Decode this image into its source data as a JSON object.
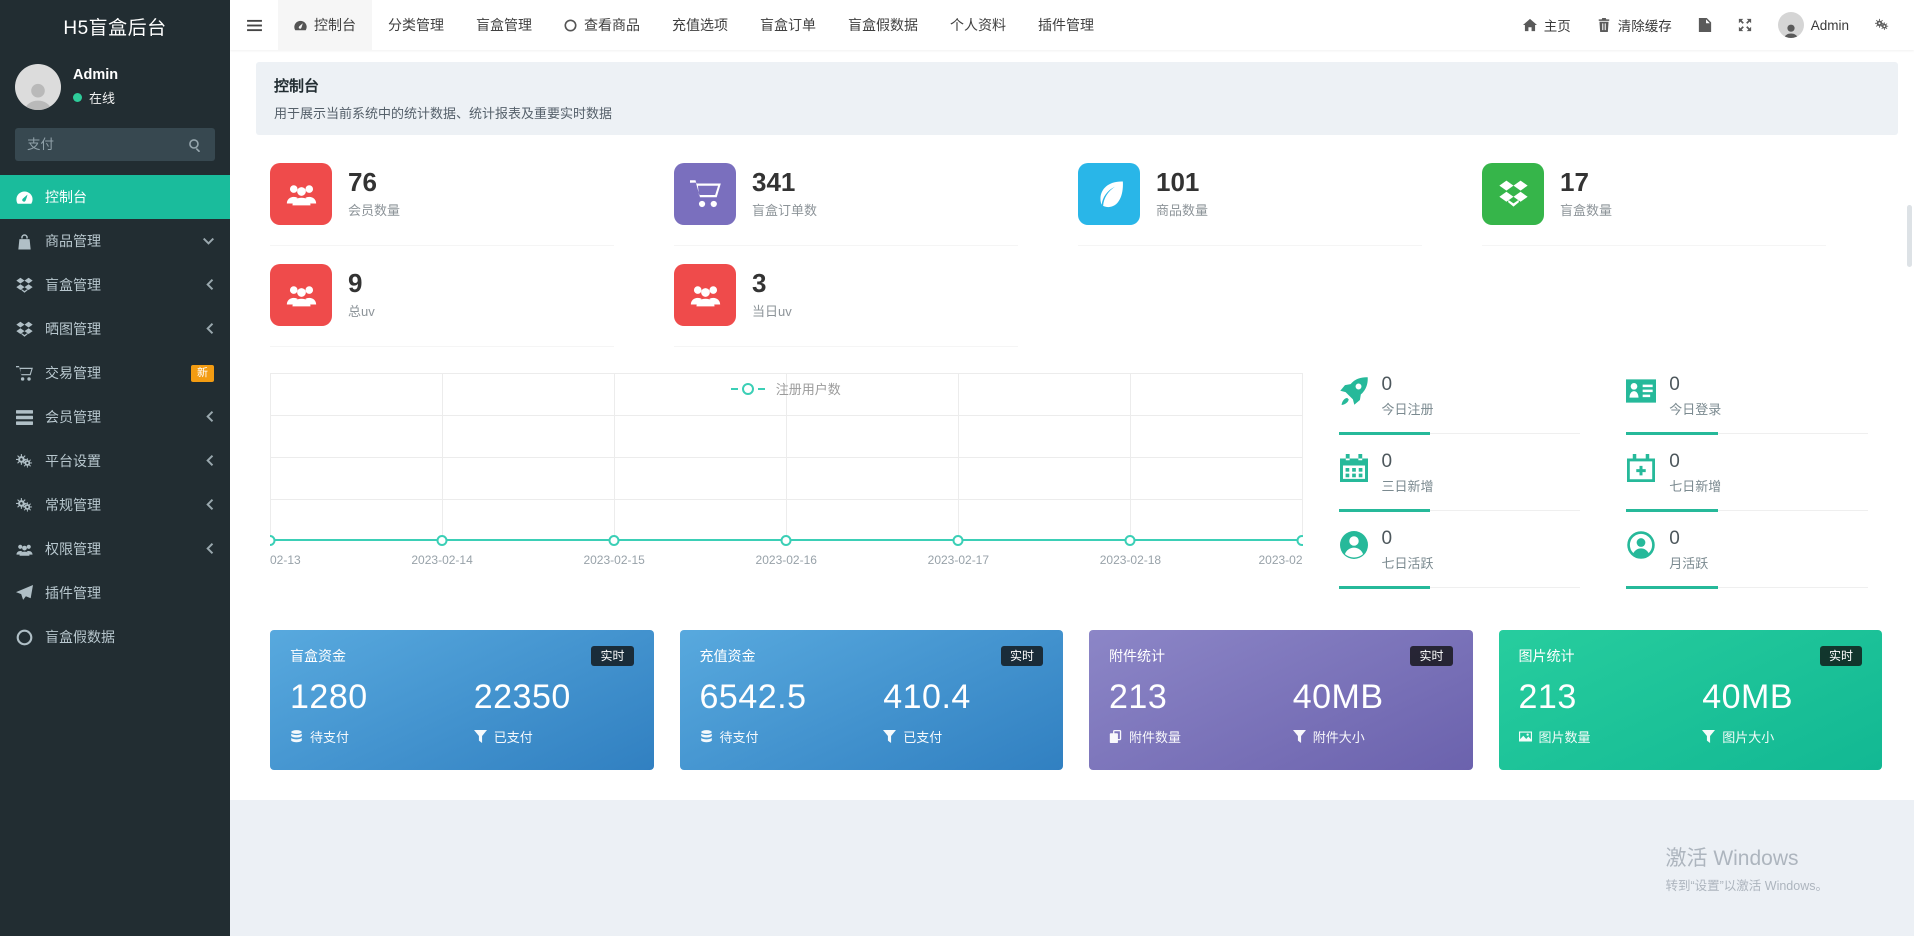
{
  "app": {
    "title": "H5盲盒后台"
  },
  "sidebar": {
    "user": {
      "name": "Admin",
      "status": "在线"
    },
    "search": {
      "placeholder": "支付"
    },
    "items": [
      {
        "label": "控制台",
        "icon": "dashboard-icon",
        "active": true
      },
      {
        "label": "商品管理",
        "icon": "shopping-bag-icon",
        "arrow": "down"
      },
      {
        "label": "盲盒管理",
        "icon": "blindbox-icon",
        "arrow": "left"
      },
      {
        "label": "晒图管理",
        "icon": "photo-box-icon",
        "arrow": "left"
      },
      {
        "label": "交易管理",
        "icon": "cart-icon",
        "badge": "新"
      },
      {
        "label": "会员管理",
        "icon": "table-icon",
        "arrow": "left"
      },
      {
        "label": "平台设置",
        "icon": "gears-icon",
        "arrow": "left"
      },
      {
        "label": "常规管理",
        "icon": "gears-icon",
        "arrow": "left"
      },
      {
        "label": "权限管理",
        "icon": "users-icon",
        "arrow": "left"
      },
      {
        "label": "插件管理",
        "icon": "paper-plane-icon"
      },
      {
        "label": "盲盒假数据",
        "icon": "circle-icon"
      }
    ]
  },
  "navbar": {
    "tabs": [
      {
        "label": "控制台",
        "icon": "dashboard-icon",
        "active": true
      },
      {
        "label": "分类管理"
      },
      {
        "label": "盲盒管理"
      },
      {
        "label": "查看商品",
        "icon": "circle-icon"
      },
      {
        "label": "充值选项"
      },
      {
        "label": "盲盒订单"
      },
      {
        "label": "盲盒假数据"
      },
      {
        "label": "个人资料"
      },
      {
        "label": "插件管理"
      }
    ],
    "home_label": "主页",
    "clear_cache_label": "清除缓存",
    "user_label": "Admin"
  },
  "page": {
    "title": "控制台",
    "subtitle": "用于展示当前系统中的统计数据、统计报表及重要实时数据"
  },
  "stats": [
    {
      "value": "76",
      "label": "会员数量",
      "color": "#ef4b4b",
      "icon": "users-icon"
    },
    {
      "value": "341",
      "label": "盲盒订单数",
      "color": "#7a6fbe",
      "icon": "cart-icon"
    },
    {
      "value": "101",
      "label": "商品数量",
      "color": "#29b6e8",
      "icon": "leaf-icon"
    },
    {
      "value": "17",
      "label": "盲盒数量",
      "color": "#36b54a",
      "icon": "blindbox-icon"
    },
    {
      "value": "9",
      "label": "总uv",
      "color": "#ef4b4b",
      "icon": "users-icon"
    },
    {
      "value": "3",
      "label": "当日uv",
      "color": "#ef4b4b",
      "icon": "users-icon"
    }
  ],
  "chart_data": {
    "type": "line",
    "title": "",
    "legend": [
      "注册用户数"
    ],
    "legend_position": "top-center",
    "x": [
      "02-13",
      "2023-02-14",
      "2023-02-15",
      "2023-02-16",
      "2023-02-17",
      "2023-02-18",
      "2023-02"
    ],
    "series": [
      {
        "name": "注册用户数",
        "values": [
          0,
          0,
          0,
          0,
          0,
          0,
          0
        ]
      }
    ],
    "ylim": [
      0,
      4
    ],
    "grid": true,
    "line_color": "#3bcfb6"
  },
  "mini_stats": [
    {
      "value": "0",
      "label": "今日注册",
      "icon": "rocket-icon"
    },
    {
      "value": "0",
      "label": "今日登录",
      "icon": "id-card-icon"
    },
    {
      "value": "0",
      "label": "三日新增",
      "icon": "calendar-icon"
    },
    {
      "value": "0",
      "label": "七日新增",
      "icon": "calendar-plus-icon"
    },
    {
      "value": "0",
      "label": "七日活跃",
      "icon": "user-circle-icon"
    },
    {
      "value": "0",
      "label": "月活跃",
      "icon": "user-circle-outline-icon"
    }
  ],
  "fund_cards": [
    {
      "title": "盲盒资金",
      "badge": "实时",
      "gradient": {
        "from": "#58a9de",
        "to": "#3180c1"
      },
      "left": {
        "value": "1280",
        "label": "待支付",
        "icon": "database-icon"
      },
      "right": {
        "value": "22350",
        "label": "已支付",
        "icon": "filter-icon"
      }
    },
    {
      "title": "充值资金",
      "badge": "实时",
      "gradient": {
        "from": "#58a9de",
        "to": "#3180c1"
      },
      "left": {
        "value": "6542.5",
        "label": "待支付",
        "icon": "database-icon"
      },
      "right": {
        "value": "410.4",
        "label": "已支付",
        "icon": "filter-icon"
      }
    },
    {
      "title": "附件统计",
      "badge": "实时",
      "gradient": {
        "from": "#8c86c7",
        "to": "#6b62ad"
      },
      "left": {
        "value": "213",
        "label": "附件数量",
        "icon": "copy-icon"
      },
      "right": {
        "value": "40MB",
        "label": "附件大小",
        "icon": "filter-icon"
      }
    },
    {
      "title": "图片统计",
      "badge": "实时",
      "gradient": {
        "from": "#27cd9e",
        "to": "#12b893"
      },
      "left": {
        "value": "213",
        "label": "图片数量",
        "icon": "image-icon"
      },
      "right": {
        "value": "40MB",
        "label": "图片大小",
        "icon": "filter-icon"
      }
    }
  ],
  "watermark": {
    "line1": "激活 Windows",
    "line2": "转到“设置”以激活 Windows。"
  },
  "theme": {
    "accent": "#1abc9c",
    "sidebar_bg": "#222d32",
    "badge_new_bg": "#f39c12",
    "mini_stat_green": "#26b99a",
    "content_bg": "#ecf0f5"
  }
}
